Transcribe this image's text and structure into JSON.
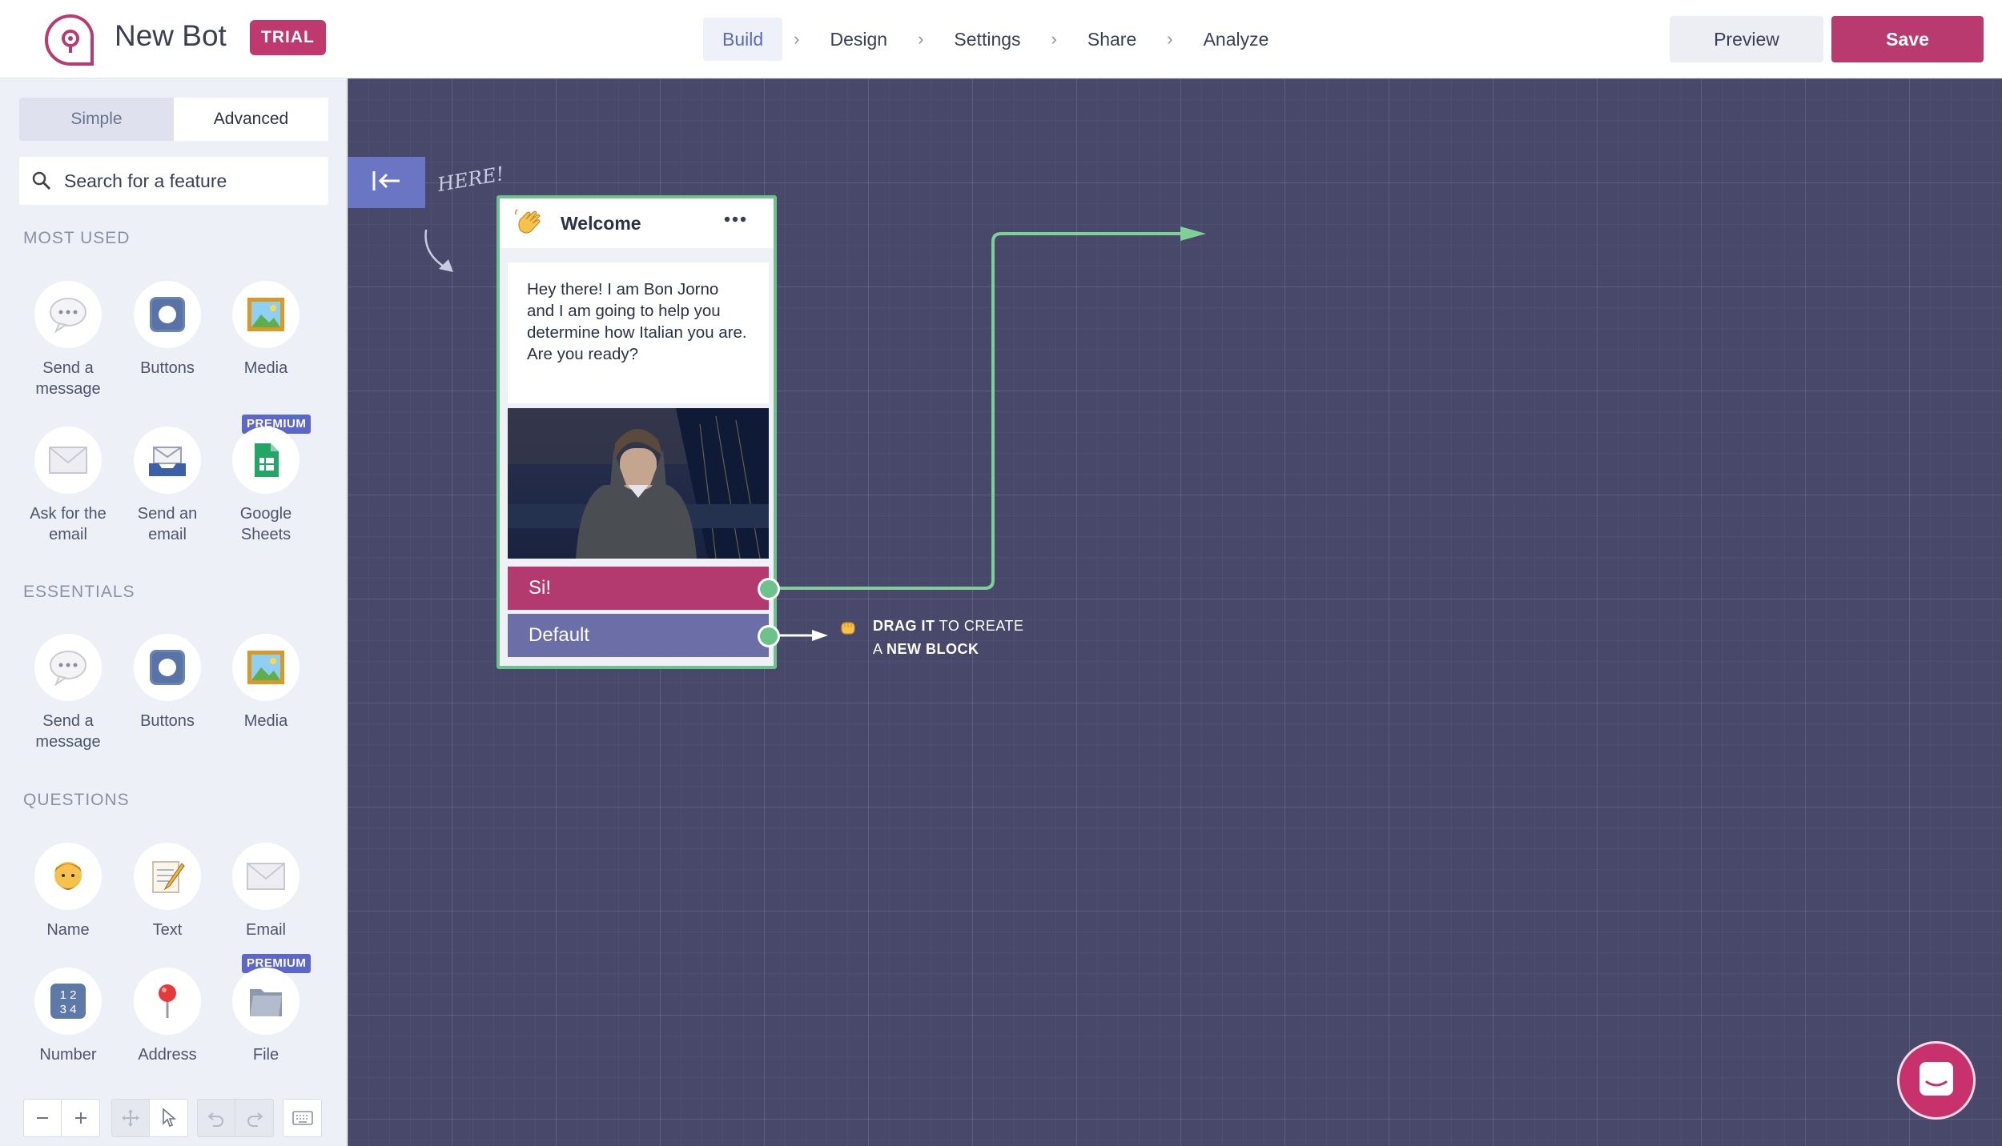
{
  "app": {
    "bot_name": "New Bot",
    "trial_label": "TRIAL",
    "accent_color": "#b93a6f"
  },
  "nav": {
    "steps": [
      "Build",
      "Design",
      "Settings",
      "Share",
      "Analyze"
    ],
    "active": "Build",
    "separator": "›"
  },
  "actions": {
    "preview_label": "Preview",
    "save_label": "Save"
  },
  "sidebar": {
    "tabs": [
      "Simple",
      "Advanced"
    ],
    "active_tab": "Advanced",
    "search_placeholder": "Search for a feature",
    "sections": [
      {
        "title": "MOST USED",
        "items": [
          {
            "label": "Send a message",
            "icon": "speech-bubble-icon"
          },
          {
            "label": "Buttons",
            "icon": "record-button-icon"
          },
          {
            "label": "Media",
            "icon": "framed-picture-icon"
          },
          {
            "label": "Ask for the email",
            "icon": "envelope-icon"
          },
          {
            "label": "Send an email",
            "icon": "envelope-tray-icon"
          },
          {
            "label": "Google Sheets",
            "icon": "google-sheets-icon",
            "badge": "PREMIUM"
          }
        ]
      },
      {
        "title": "ESSENTIALS",
        "items": [
          {
            "label": "Send a message",
            "icon": "speech-bubble-icon"
          },
          {
            "label": "Buttons",
            "icon": "record-button-icon"
          },
          {
            "label": "Media",
            "icon": "framed-picture-icon"
          }
        ]
      },
      {
        "title": "QUESTIONS",
        "items": [
          {
            "label": "Name",
            "icon": "person-face-icon"
          },
          {
            "label": "Text",
            "icon": "memo-icon"
          },
          {
            "label": "Email",
            "icon": "envelope-icon"
          },
          {
            "label": "Number",
            "icon": "numbers-icon"
          },
          {
            "label": "Address",
            "icon": "pin-icon"
          },
          {
            "label": "File",
            "icon": "file-folder-icon",
            "badge": "PREMIUM"
          }
        ]
      }
    ]
  },
  "canvas": {
    "start_hint": "HERE!",
    "block": {
      "title": "Welcome",
      "icon": "waving-hand-icon",
      "message": "Hey there!  I am Bon Jorno and I am going to help you determine how Italian you are. Are you ready?",
      "buttons": [
        "Si!",
        "Default"
      ]
    },
    "drag_hint": {
      "line1_bold": "DRAG IT",
      "line1_rest": " TO CREATE",
      "line2_pre": "A ",
      "line2_bold": "NEW BLOCK"
    }
  }
}
